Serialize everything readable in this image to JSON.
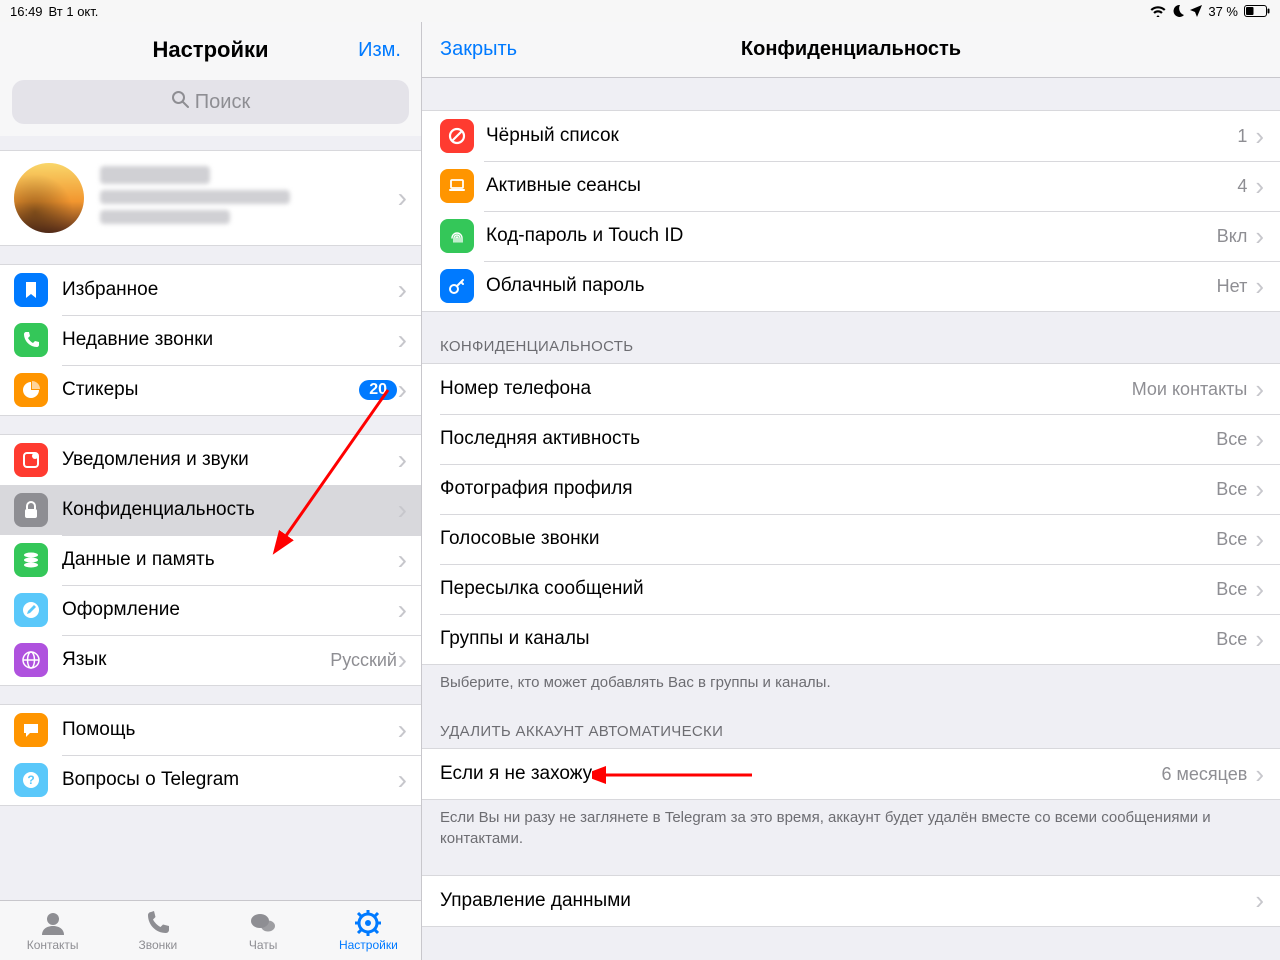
{
  "status": {
    "time": "16:49",
    "date": "Вт 1 окт.",
    "battery_text": "37 %"
  },
  "left": {
    "title": "Настройки",
    "edit": "Изм.",
    "search_placeholder": "Поиск",
    "sections": [
      {
        "items": [
          {
            "id": "favorites",
            "label": "Избранное",
            "color": "ic-blue",
            "icon": "bookmark"
          },
          {
            "id": "recent-calls",
            "label": "Недавние звонки",
            "color": "ic-green",
            "icon": "phone"
          },
          {
            "id": "stickers",
            "label": "Стикеры",
            "color": "ic-orange",
            "icon": "pie",
            "badge": "20"
          }
        ]
      },
      {
        "items": [
          {
            "id": "notifications",
            "label": "Уведомления и звуки",
            "color": "ic-red",
            "icon": "bell"
          },
          {
            "id": "privacy",
            "label": "Конфиденциальность",
            "color": "ic-gray",
            "icon": "lock",
            "selected": true
          },
          {
            "id": "data",
            "label": "Данные и память",
            "color": "ic-green",
            "icon": "stack"
          },
          {
            "id": "appearance",
            "label": "Оформление",
            "color": "ic-teal",
            "icon": "pencil"
          },
          {
            "id": "language",
            "label": "Язык",
            "color": "ic-purple",
            "icon": "globe",
            "value": "Русский"
          }
        ]
      },
      {
        "items": [
          {
            "id": "help",
            "label": "Помощь",
            "color": "ic-orange",
            "icon": "chat"
          },
          {
            "id": "faq",
            "label": "Вопросы о Telegram",
            "color": "ic-teal",
            "icon": "question"
          }
        ]
      }
    ],
    "tabs": [
      {
        "id": "contacts",
        "label": "Контакты",
        "icon": "person"
      },
      {
        "id": "calls",
        "label": "Звонки",
        "icon": "phone"
      },
      {
        "id": "chats",
        "label": "Чаты",
        "icon": "chats"
      },
      {
        "id": "settings",
        "label": "Настройки",
        "icon": "gear",
        "active": true
      }
    ]
  },
  "right": {
    "close": "Закрыть",
    "title": "Конфиденциальность",
    "group1": [
      {
        "id": "blacklist",
        "label": "Чёрный список",
        "value": "1",
        "color": "ic-red",
        "icon": "forbidden"
      },
      {
        "id": "sessions",
        "label": "Активные сеансы",
        "value": "4",
        "color": "ic-orange",
        "icon": "laptop"
      },
      {
        "id": "passcode",
        "label": "Код-пароль и Touch ID",
        "value": "Вкл",
        "color": "ic-green",
        "icon": "fingerprint"
      },
      {
        "id": "cloudpass",
        "label": "Облачный пароль",
        "value": "Нет",
        "color": "ic-blue",
        "icon": "key"
      }
    ],
    "group2_header": "КОНФИДЕНЦИАЛЬНОСТЬ",
    "group2": [
      {
        "id": "phone",
        "label": "Номер телефона",
        "value": "Мои контакты"
      },
      {
        "id": "lastseen",
        "label": "Последняя активность",
        "value": "Все"
      },
      {
        "id": "photo",
        "label": "Фотография профиля",
        "value": "Все"
      },
      {
        "id": "voice",
        "label": "Голосовые звонки",
        "value": "Все"
      },
      {
        "id": "forward",
        "label": "Пересылка сообщений",
        "value": "Все"
      },
      {
        "id": "groups",
        "label": "Группы и каналы",
        "value": "Все"
      }
    ],
    "group2_footer": "Выберите, кто может добавлять Вас в группы и каналы.",
    "group3_header": "УДАЛИТЬ АККАУНТ АВТОМАТИЧЕСКИ",
    "group3": [
      {
        "id": "ifaway",
        "label": "Если я не захожу",
        "value": "6 месяцев"
      }
    ],
    "group3_footer": "Если Вы ни разу не заглянете в Telegram за это время, аккаунт будет удалён вместе со всеми сообщениями и контактами.",
    "group4": [
      {
        "id": "datacontrol",
        "label": "Управление данными",
        "value": ""
      }
    ]
  }
}
